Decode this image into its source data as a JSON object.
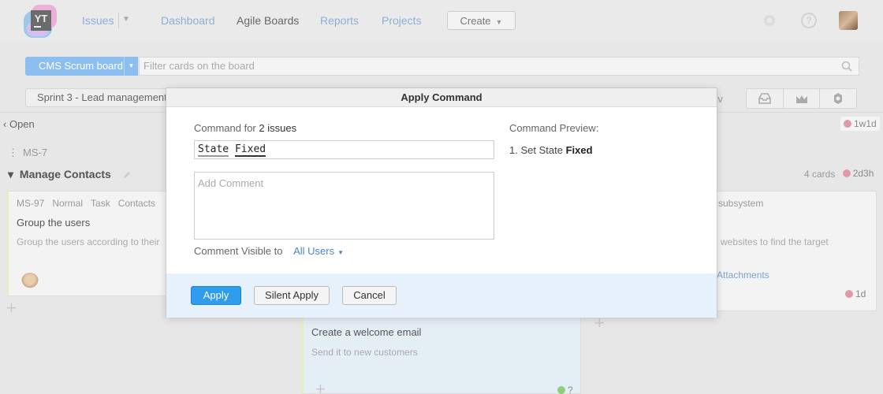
{
  "header": {
    "logo_text": "YT",
    "nav": {
      "issues": "Issues",
      "dashboard": "Dashboard",
      "agile_boards": "Agile Boards",
      "reports": "Reports",
      "projects": "Projects"
    },
    "create_label": "Create"
  },
  "toolbar": {
    "board_label": "CMS Scrum board",
    "filter_placeholder": "Filter cards on the board",
    "sprint_label": "Sprint 3 - Lead management",
    "right_partial_text": "rv"
  },
  "board": {
    "column_open": "Open",
    "top_right_time": "1w1d",
    "parent_issue": "MS-7",
    "swimlane_title": "Manage Contacts",
    "cards_count": "4 cards",
    "swimlane_time": "2d3h",
    "cards": [
      {
        "id": "MS-97",
        "priority": "Normal",
        "type": "Task",
        "subsystem": "Contacts",
        "title": "Group the users",
        "description": "Group the users according to their"
      },
      {
        "title": "Create a welcome email",
        "description": "Send it to new customers",
        "time": "?"
      },
      {
        "meta": "subsystem",
        "description": "websites to find the target",
        "link": "Attachments",
        "time": "1d"
      }
    ]
  },
  "modal": {
    "title": "Apply Command",
    "command_for_prefix": "Command for",
    "command_for_count": "2 issues",
    "command_word1": "State",
    "command_word2": "Fixed",
    "comment_placeholder": "Add Comment",
    "visible_label": "Comment Visible to",
    "visible_value": "All Users",
    "preview_label": "Command Preview:",
    "preview_prefix": "1. Set State",
    "preview_value": "Fixed",
    "apply_label": "Apply",
    "silent_apply_label": "Silent Apply",
    "cancel_label": "Cancel"
  }
}
